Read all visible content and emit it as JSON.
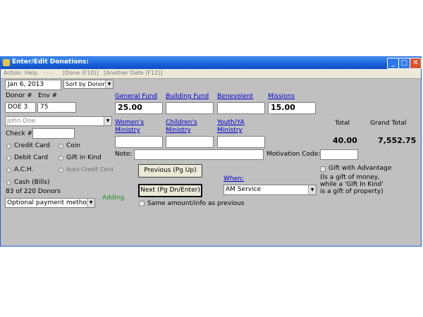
{
  "window": {
    "title": "Enter/Edit Donations:"
  },
  "menu": {
    "action": "Action",
    "help": "Help",
    "dashes": "- - -",
    "done": "[Done (F10)]",
    "another_date": "[Another Date (F12)]"
  },
  "date": "Jan 6, 2013",
  "sort": "Sort by Donor #",
  "donor": {
    "donor_label": "Donor #",
    "env_label": "Env #",
    "donor_value": "DOE  3",
    "env_value": "75",
    "name": "John Doe"
  },
  "check": {
    "label": "Check #",
    "value": ""
  },
  "payment": {
    "credit_card": "Credit Card",
    "coin": "Coin",
    "debit_card": "Debit Card",
    "gift_in_kind": "Gift in Kind",
    "ach": "A.C.H.",
    "auto_credit_card": "Auto Credit Card",
    "cash": "Cash (Bills)"
  },
  "donors_count": "83 of 220 Donors",
  "adding": "Adding",
  "optional_payment": "Optional payment method",
  "funds_row1": [
    {
      "label": "General Fund",
      "value": "25.00"
    },
    {
      "label": "Building Fund",
      "value": ""
    },
    {
      "label": "Benevolent",
      "value": ""
    },
    {
      "label": "Missions",
      "value": "15.00"
    }
  ],
  "funds_row2": [
    {
      "label1": "Women's",
      "label2": "Ministry",
      "value": ""
    },
    {
      "label1": "Children's",
      "label2": "Ministry",
      "value": ""
    },
    {
      "label1": "Youth/YA",
      "label2": "Ministry",
      "value": ""
    }
  ],
  "totals": {
    "total_label": "Total",
    "grand_label": "Grand Total",
    "total_value": "40.00",
    "grand_value": "7,552.75"
  },
  "note": {
    "label": "Note:",
    "value": ""
  },
  "motivation": {
    "label": "Motivation Code:",
    "value": ""
  },
  "buttons": {
    "previous": "Previous (Pg Up)",
    "next": "Next (Pg Dn/Enter)"
  },
  "when": {
    "label": "When:",
    "value": "AM Service"
  },
  "same_amount": "Same amount/info as previous",
  "gift_advantage": {
    "label": "Gift with Advantage",
    "note1": "(Is a gift of money,",
    "note2": " while a 'Gift In Kind'",
    "note3": " is a gift of property)"
  }
}
